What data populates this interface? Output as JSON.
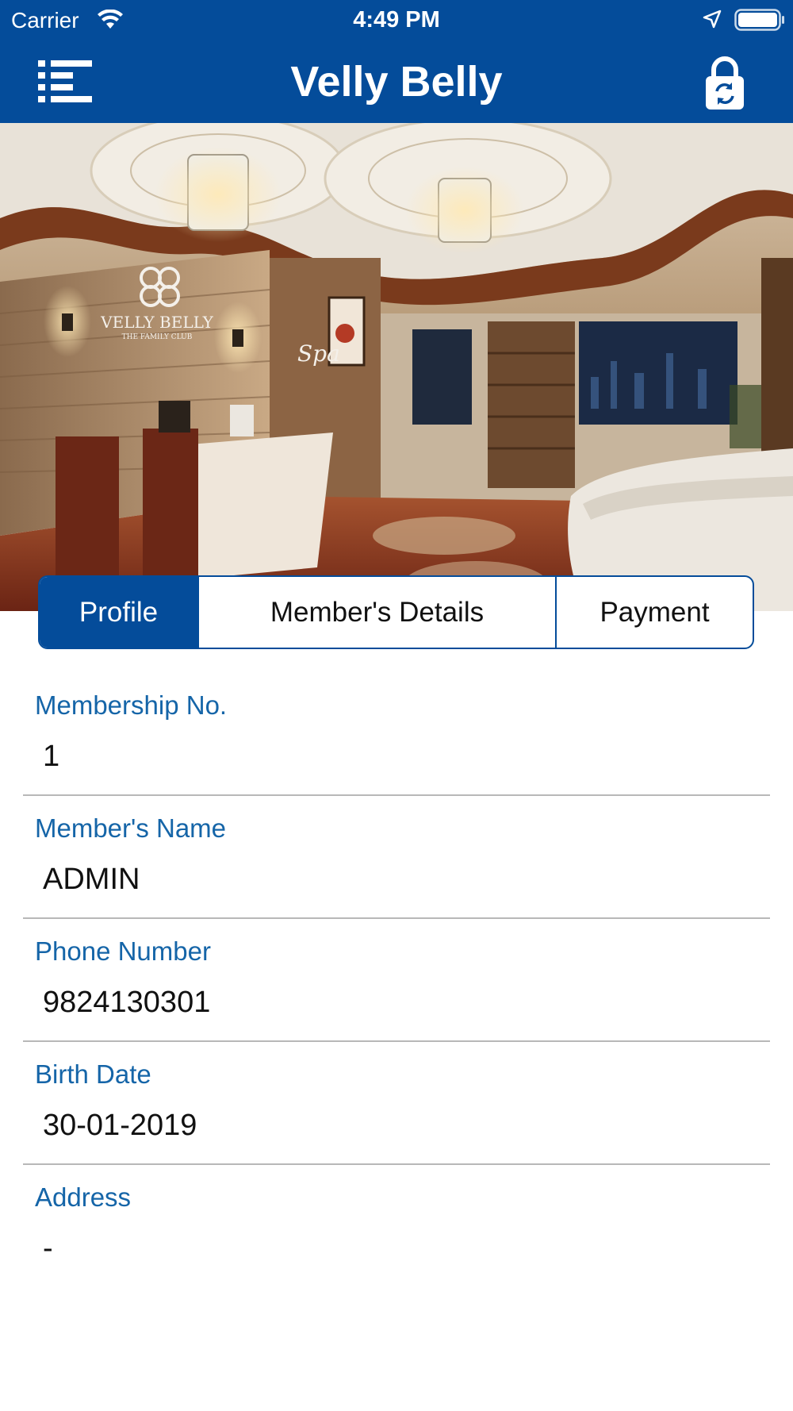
{
  "status_bar": {
    "carrier": "Carrier",
    "time": "4:49 PM"
  },
  "nav": {
    "title": "Velly Belly",
    "menu_icon": "list-menu-icon",
    "lock_icon": "lock-refresh-icon"
  },
  "hero": {
    "logo_text": "VELLY BELLY",
    "logo_tagline": "THE FAMILY CLUB",
    "spa_sign": "Spa"
  },
  "tabs": [
    {
      "label": "Profile",
      "active": true
    },
    {
      "label": "Member's Details",
      "active": false
    },
    {
      "label": "Payment",
      "active": false
    }
  ],
  "fields": [
    {
      "label": "Membership No.",
      "value": "1"
    },
    {
      "label": "Member's Name",
      "value": "ADMIN"
    },
    {
      "label": "Phone Number",
      "value": "9824130301"
    },
    {
      "label": "Birth Date",
      "value": "30-01-2019"
    },
    {
      "label": "Address",
      "value": "-"
    }
  ],
  "colors": {
    "primary": "#044c9a",
    "label": "#1565a8",
    "divider": "#b8b8b8"
  }
}
